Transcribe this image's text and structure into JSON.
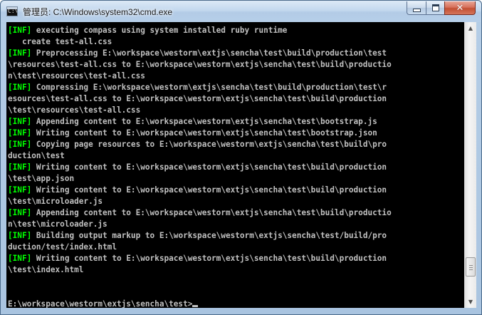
{
  "window": {
    "title": "管理员: C:\\Windows\\system32\\cmd.exe",
    "icon": "console-icon",
    "icon_glyph": "C:\\",
    "buttons": {
      "minimize": "minimize-icon",
      "maximize": "maximize-icon",
      "close_glyph": "✕"
    }
  },
  "console": {
    "lines": [
      {
        "tag": "[INF]",
        "text": " executing compass using system installed ruby runtime"
      },
      {
        "tag": "",
        "text": "   create test-all.css"
      },
      {
        "tag": "[INF]",
        "text": " Preprocessing E:\\workspace\\westorm\\extjs\\sencha\\test\\build\\production\\test"
      },
      {
        "tag": "",
        "text": "\\resources\\test-all.css to E:\\workspace\\westorm\\extjs\\sencha\\test\\build\\productio"
      },
      {
        "tag": "",
        "text": "n\\test\\resources\\test-all.css"
      },
      {
        "tag": "[INF]",
        "text": " Compressing E:\\workspace\\westorm\\extjs\\sencha\\test\\build\\production\\test\\r"
      },
      {
        "tag": "",
        "text": "esources\\test-all.css to E:\\workspace\\westorm\\extjs\\sencha\\test\\build\\production"
      },
      {
        "tag": "",
        "text": "\\test\\resources\\test-all.css"
      },
      {
        "tag": "[INF]",
        "text": " Appending content to E:\\workspace\\westorm\\extjs\\sencha\\test\\bootstrap.js"
      },
      {
        "tag": "[INF]",
        "text": " Writing content to E:\\workspace\\westorm\\extjs\\sencha\\test\\bootstrap.json"
      },
      {
        "tag": "[INF]",
        "text": " Copying page resources to E:\\workspace\\westorm\\extjs\\sencha\\test\\build\\pro"
      },
      {
        "tag": "",
        "text": "duction\\test"
      },
      {
        "tag": "[INF]",
        "text": " Writing content to E:\\workspace\\westorm\\extjs\\sencha\\test\\build\\production"
      },
      {
        "tag": "",
        "text": "\\test\\app.json"
      },
      {
        "tag": "[INF]",
        "text": " Writing content to E:\\workspace\\westorm\\extjs\\sencha\\test\\build\\production"
      },
      {
        "tag": "",
        "text": "\\test\\microloader.js"
      },
      {
        "tag": "[INF]",
        "text": " Appending content to E:\\workspace\\westorm\\extjs\\sencha\\test\\build\\productio"
      },
      {
        "tag": "",
        "text": "n\\test\\microloader.js"
      },
      {
        "tag": "[INF]",
        "text": " Building output markup to E:\\workspace\\westorm\\extjs\\sencha\\test/build/pro"
      },
      {
        "tag": "",
        "text": "duction/test/index.html"
      },
      {
        "tag": "[INF]",
        "text": " Writing content to E:\\workspace\\westorm\\extjs\\sencha\\test\\build\\production"
      },
      {
        "tag": "",
        "text": "\\test\\index.html"
      },
      {
        "tag": "",
        "text": ""
      },
      {
        "tag": "",
        "text": ""
      },
      {
        "tag": "",
        "text": "E:\\workspace\\westorm\\extjs\\sencha\\test>"
      }
    ],
    "colors": {
      "background": "#000000",
      "text": "#c0c0c0",
      "tag": "#00ff00"
    }
  },
  "scrollbar": {
    "up_arrow": "▲",
    "down_arrow": "▼",
    "position": 0.92
  }
}
